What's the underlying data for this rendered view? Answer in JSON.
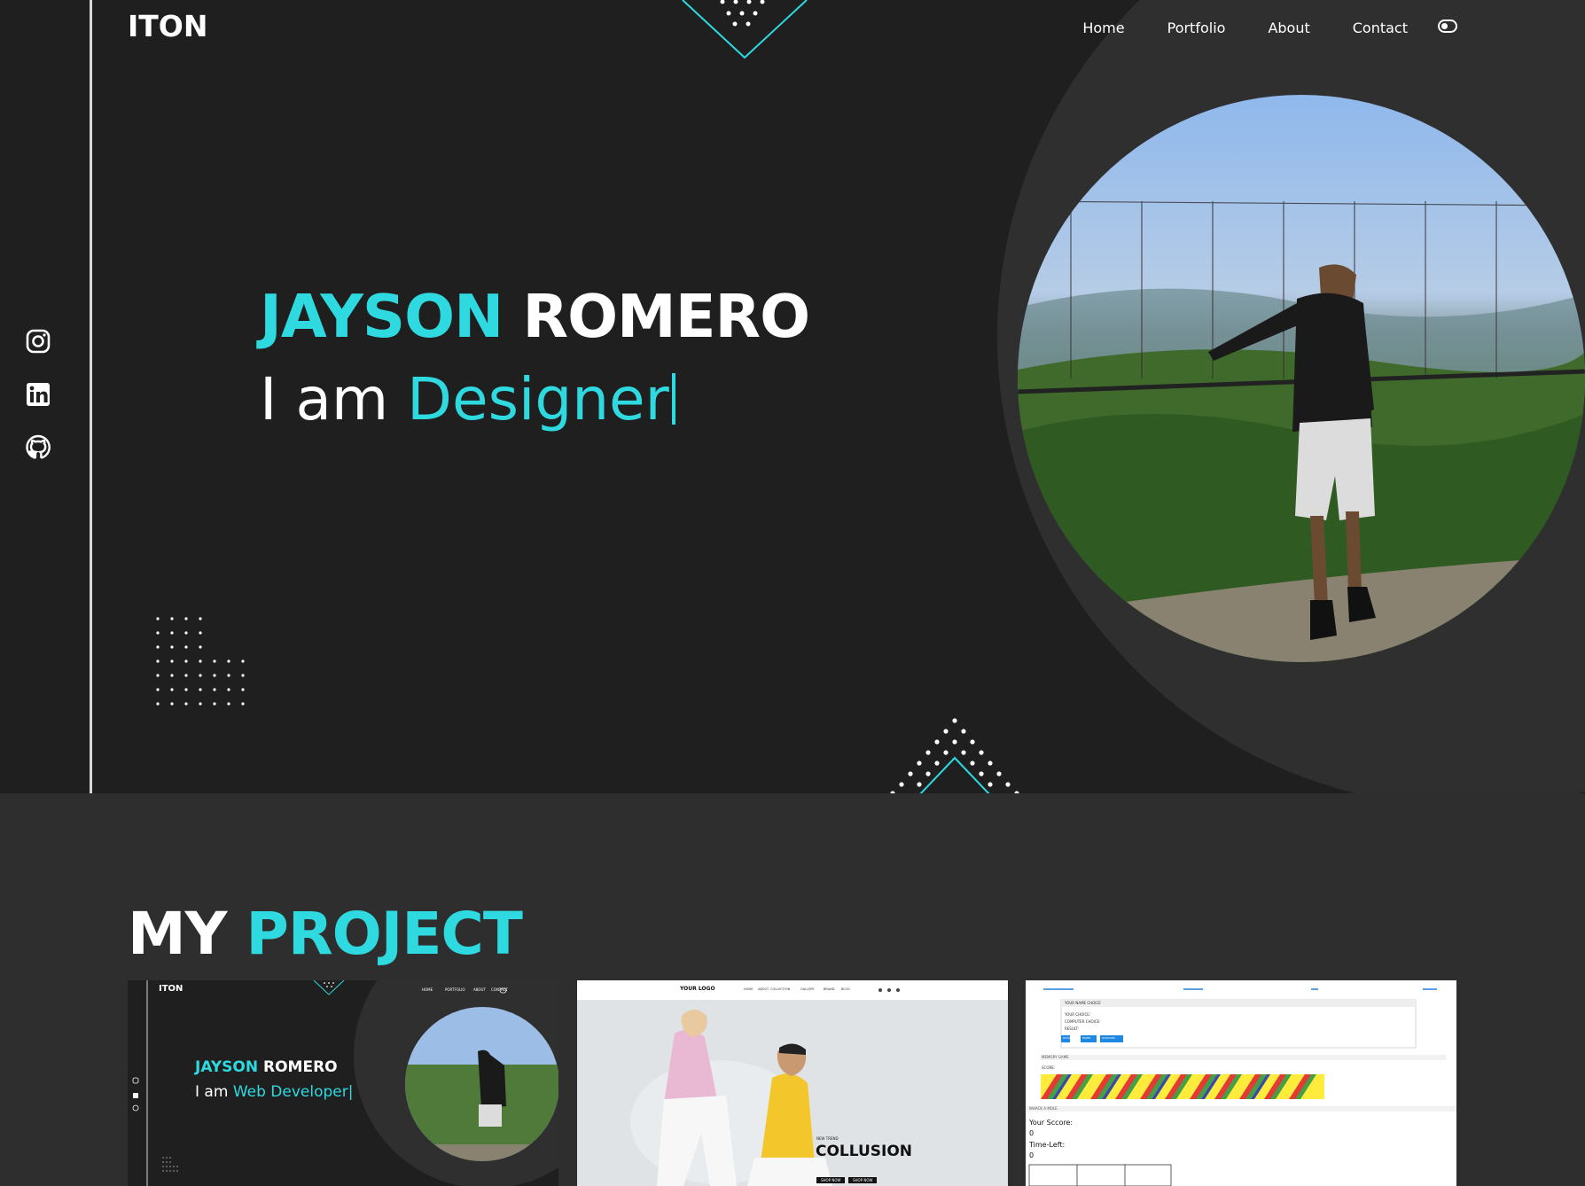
{
  "header": {
    "logo": "ITON",
    "nav": [
      "Home",
      "Portfolio",
      "About",
      "Contact"
    ]
  },
  "hero": {
    "first_name": "JAYSON",
    "last_name": "ROMERO",
    "role_prefix": "I am",
    "role": "Designer"
  },
  "socials": [
    "instagram-icon",
    "linkedin-icon",
    "github-icon"
  ],
  "projects": {
    "title_part1": "MY",
    "title_part2": "PROJECT",
    "cards": [
      {
        "logo": "ITON",
        "nav": [
          "HOME",
          "PORTFOLIO",
          "ABOUT",
          "CONTACT"
        ],
        "first_name": "JAYSON",
        "last_name": "ROMERO",
        "role_prefix": "I am",
        "role": "Web Developer"
      },
      {
        "logo": "YOUR LOGO",
        "nav": [
          "HOME",
          "ABOUT",
          "COLLECTION",
          "GALLERY",
          "BRAND",
          "BLOG"
        ],
        "kicker": "NEW TREND",
        "headline": "COLLUSION",
        "buttons": [
          "SHOP NOW",
          "SHOP NOW"
        ]
      },
      {
        "heading1": "YOUR NAME CHOICE",
        "lines": [
          "YOUR CHOICE:",
          "COMPUTER CHOICE:",
          "RESULT:"
        ],
        "buttons": [
          "ROCK",
          "PAPER",
          "SCISSORS"
        ],
        "section2": "MEMORY GAME",
        "score_label": "SCORE:",
        "section3": "WHACK A MOLE",
        "your_score": "Your Sccore:",
        "your_score_value": "0",
        "time_left": "Time-Left:",
        "time_left_value": "0"
      }
    ]
  },
  "colors": {
    "accent": "#2fd9e0",
    "hero_bg": "#1f1f1f",
    "page_bg": "#2e2e2e"
  }
}
